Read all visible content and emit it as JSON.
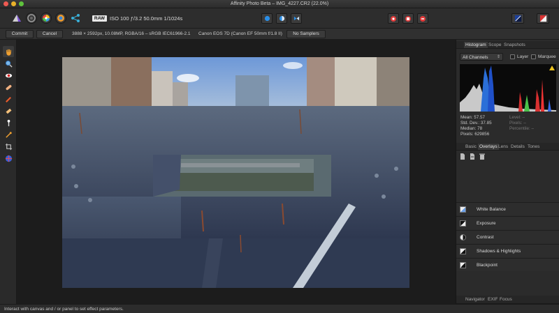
{
  "window": {
    "title": "Affinity Photo Beta – IMG_4227.CR2 (22.0%)"
  },
  "colors": {
    "accent": "#2a7fd4",
    "panel_bg": "#2b2b2b",
    "canvas_bg": "#1c1c1c",
    "warning": "#e8c020"
  },
  "toolbar": {
    "personas": [
      "photo-persona-icon",
      "liquify-persona-icon",
      "develop-persona-icon",
      "tone-mapping-persona-icon",
      "export-persona-icon"
    ],
    "raw_badge": "RAW",
    "exif_summary": "ISO 100 ƒ/3.2 50.0mm 1/1024s"
  },
  "context": {
    "commit_label": "Commit",
    "cancel_label": "Cancel",
    "image_info": "3888 × 2592px, 10.08MP, RGBA/16 – sRGB IEC61966-2.1",
    "camera_info": "Canon EOS 7D (Canon EF 50mm f/1.8 II)",
    "samplers_label": "No Samplers"
  },
  "tools": [
    "hand-icon",
    "zoom-icon",
    "red-eye-icon",
    "blemish-icon",
    "brush-icon",
    "eraser-icon",
    "gradient-icon",
    "white-balance-picker-icon",
    "crop-icon",
    "lens-grid-icon"
  ],
  "histogram_panel": {
    "tabs": [
      "Histogram",
      "Scope",
      "Snapshots"
    ],
    "channel_select": "All Channels",
    "layer_label": "Layer",
    "marquee_label": "Marquee",
    "stats": {
      "mean": "Mean: 57.57",
      "stddev": "Std. Dev.: 37.85",
      "median": "Median: 78",
      "pixels": "Pixels: 629856",
      "level": "Level: –",
      "pixels_alt": "Pixels: –",
      "percentile": "Percentile: –"
    }
  },
  "overlays_panel": {
    "tabs": [
      "Basic",
      "Overlays",
      "Lens",
      "Details",
      "Tones"
    ],
    "adjustments": [
      "White Balance",
      "Exposure",
      "Contrast",
      "Shadows & Highlights",
      "Blackpoint"
    ]
  },
  "bottom_tabs": [
    "Navigator",
    "EXIF",
    "Focus"
  ],
  "status": {
    "text": "Interact with canvas and / or panel to set effect parameters."
  }
}
